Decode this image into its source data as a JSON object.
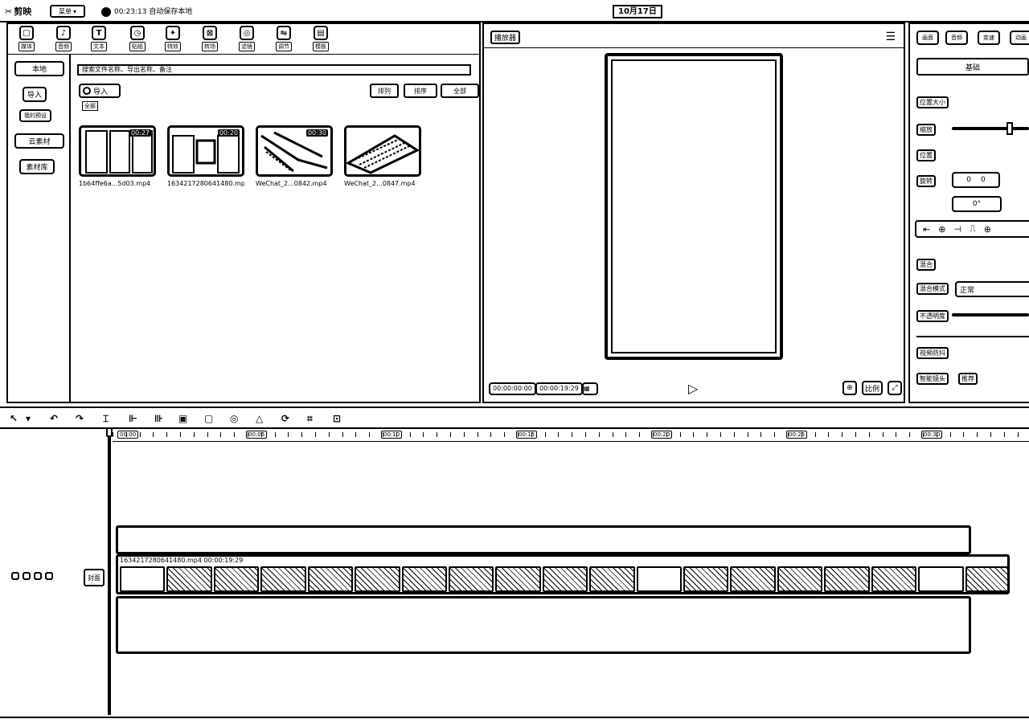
{
  "titlebar": {
    "app_name": "剪映",
    "menu_label": "菜单",
    "status_text": "00:23:13 自动保存本地",
    "date": "10月17日"
  },
  "media": {
    "tabs": [
      {
        "label": "媒体",
        "icon": "media-icon"
      },
      {
        "label": "音频",
        "icon": "audio-icon"
      },
      {
        "label": "文本",
        "icon": "text-icon"
      },
      {
        "label": "贴纸",
        "icon": "sticker-icon"
      },
      {
        "label": "特效",
        "icon": "effects-icon"
      },
      {
        "label": "转场",
        "icon": "transition-icon"
      },
      {
        "label": "滤镜",
        "icon": "filter-icon"
      },
      {
        "label": "调节",
        "icon": "adjust-icon"
      },
      {
        "label": "模板",
        "icon": "template-icon"
      }
    ],
    "side": [
      "本地",
      "导入",
      "我的预设",
      "云素材",
      "素材库"
    ],
    "search_placeholder": "搜索文件名称、导出名称、备注",
    "import_label": "导入",
    "view_label": "排列",
    "sort_label": "排序",
    "all_label": "全部",
    "filter_label": "全部",
    "items": [
      {
        "name": "1b64ffe6a...5d03.mp4",
        "duration": "00:27"
      },
      {
        "name": "1634217280641480.mp4",
        "duration": "00:20"
      },
      {
        "name": "WeChat_2...0842.mp4",
        "duration": "00:30"
      },
      {
        "name": "WeChat_2...0847.mp4",
        "duration": ""
      }
    ]
  },
  "player": {
    "label": "播放器",
    "current_time": "00:00:00:00",
    "total_time": "00:00:19:29",
    "ratio_label": "比例"
  },
  "props": {
    "tabs": [
      "画面",
      "音频",
      "变速",
      "动画"
    ],
    "basic_button": "基础",
    "position_size": "位置大小",
    "scale_label": "缩放",
    "position_label": "位置",
    "position_x": "0",
    "position_y": "0",
    "rotation_label": "旋转",
    "rotation_value": "0°",
    "blend_label": "混合",
    "blend_mode_label": "混合模式",
    "blend_mode_value": "正常",
    "opacity_label": "不透明度",
    "stabilize_label": "视频防抖",
    "stabilize_option": "推荐",
    "resize_label": "智能镜头"
  },
  "timeline": {
    "clip_title": "1634217280641480.mp4  00:00:19:29",
    "cover_label": "封面",
    "ruler_labels": [
      "00:00",
      "00:05",
      "00:10",
      "00:15",
      "00:20",
      "00:25",
      "00:30"
    ]
  }
}
